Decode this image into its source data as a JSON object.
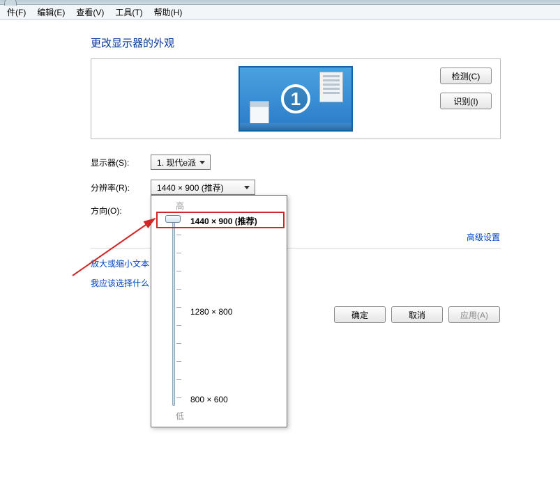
{
  "menubar": {
    "file": "件(F)",
    "edit": "编辑(E)",
    "view": "查看(V)",
    "tools": "工具(T)",
    "help": "帮助(H)"
  },
  "page_title": "更改显示器的外观",
  "monitor_number": "1",
  "buttons": {
    "detect": "检测(C)",
    "identify": "识别(I)",
    "ok": "确定",
    "cancel": "取消",
    "apply": "应用(A)"
  },
  "form": {
    "display_label": "显示器(S):",
    "display_value": "1. 现代e派",
    "resolution_label": "分辨率(R):",
    "resolution_value": "1440 × 900 (推荐)",
    "orientation_label": "方向(O):"
  },
  "slider": {
    "high": "高",
    "low": "低",
    "current": "1440 × 900 (推荐)",
    "mid": "1280 × 800",
    "lowres": "800 × 600"
  },
  "links": {
    "zoom_text": "放大或缩小文本",
    "help_choose": "我应该选择什么",
    "advanced": "高级设置"
  }
}
